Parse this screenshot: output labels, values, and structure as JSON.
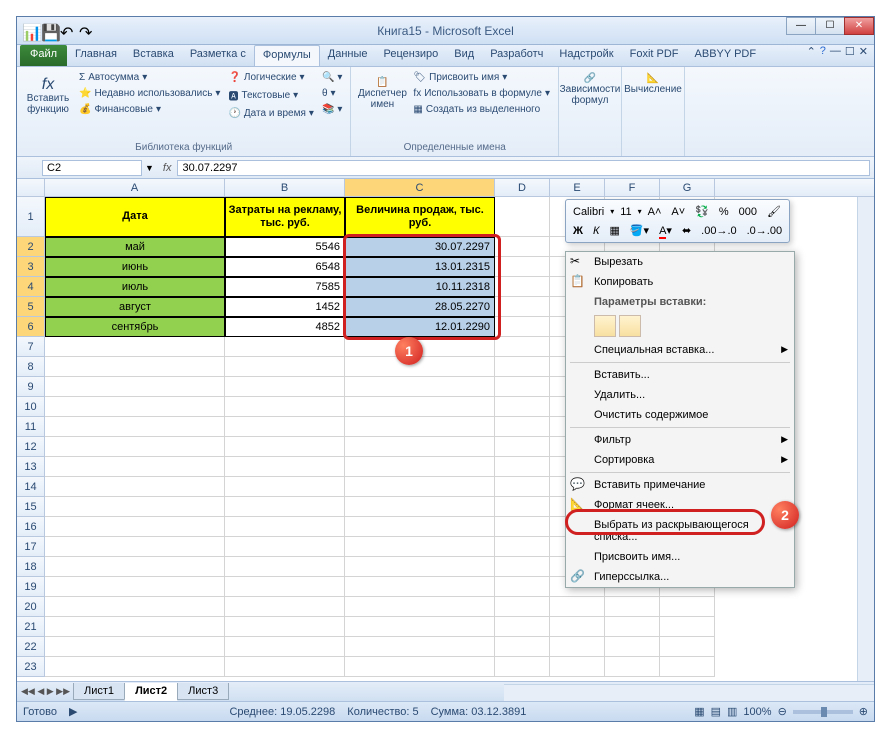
{
  "title": "Книга15 - Microsoft Excel",
  "tabs": {
    "file": "Файл",
    "items": [
      "Главная",
      "Вставка",
      "Разметка с",
      "Формулы",
      "Данные",
      "Рецензиро",
      "Вид",
      "Разработч",
      "Надстройк",
      "Foxit PDF",
      "ABBYY PDF"
    ],
    "active_index": 3
  },
  "ribbon": {
    "insert_fn": "Вставить функцию",
    "autosum": "Автосумма",
    "recent": "Недавно использовались",
    "financial": "Финансовые",
    "logical": "Логические",
    "text": "Текстовые",
    "datetime": "Дата и время",
    "lib_label": "Библиотека функций",
    "name_mgr": "Диспетчер имен",
    "assign_name": "Присвоить имя",
    "use_in_formula": "Использовать в формуле",
    "create_from_sel": "Создать из выделенного",
    "defined_names": "Определенные имена",
    "deps": "Зависимости формул",
    "calc": "Вычисление"
  },
  "namebox": "C2",
  "formula": "30.07.2297",
  "headers": {
    "A": "A",
    "B": "B",
    "C": "C",
    "D": "D",
    "E": "E",
    "F": "F",
    "G": "G"
  },
  "table": {
    "h1": "Дата",
    "h2": "Затраты на рекламу, тыс. руб.",
    "h3": "Величина продаж, тыс. руб.",
    "rows": [
      {
        "n": "2",
        "a": "май",
        "b": "5546",
        "c": "30.07.2297"
      },
      {
        "n": "3",
        "a": "июнь",
        "b": "6548",
        "c": "13.01.2315"
      },
      {
        "n": "4",
        "a": "июль",
        "b": "7585",
        "c": "10.11.2318"
      },
      {
        "n": "5",
        "a": "август",
        "b": "1452",
        "c": "28.05.2270"
      },
      {
        "n": "6",
        "a": "сентябрь",
        "b": "4852",
        "c": "12.01.2290"
      }
    ],
    "empty_rows": [
      "7",
      "8",
      "9",
      "10",
      "11",
      "12",
      "13",
      "14",
      "15",
      "16",
      "17",
      "18",
      "19",
      "20",
      "21",
      "22",
      "23"
    ]
  },
  "mini_toolbar": {
    "font": "Calibri",
    "size": "11"
  },
  "context_menu": {
    "cut": "Вырезать",
    "copy": "Копировать",
    "paste_opts_hdr": "Параметры вставки:",
    "paste_special": "Специальная вставка...",
    "insert": "Вставить...",
    "delete": "Удалить...",
    "clear": "Очистить содержимое",
    "filter": "Фильтр",
    "sort": "Сортировка",
    "comment": "Вставить примечание",
    "format_cells": "Формат ячеек...",
    "dropdown": "Выбрать из раскрывающегося списка...",
    "assign_name": "Присвоить имя...",
    "hyperlink": "Гиперссылка..."
  },
  "sheet_tabs": {
    "s1": "Лист1",
    "s2": "Лист2",
    "s3": "Лист3"
  },
  "status": {
    "ready": "Готово",
    "avg": "Среднее: 19.05.2298",
    "count": "Количество: 5",
    "sum": "Сумма: 03.12.3891",
    "zoom": "100%"
  },
  "callouts": {
    "c1": "1",
    "c2": "2"
  }
}
